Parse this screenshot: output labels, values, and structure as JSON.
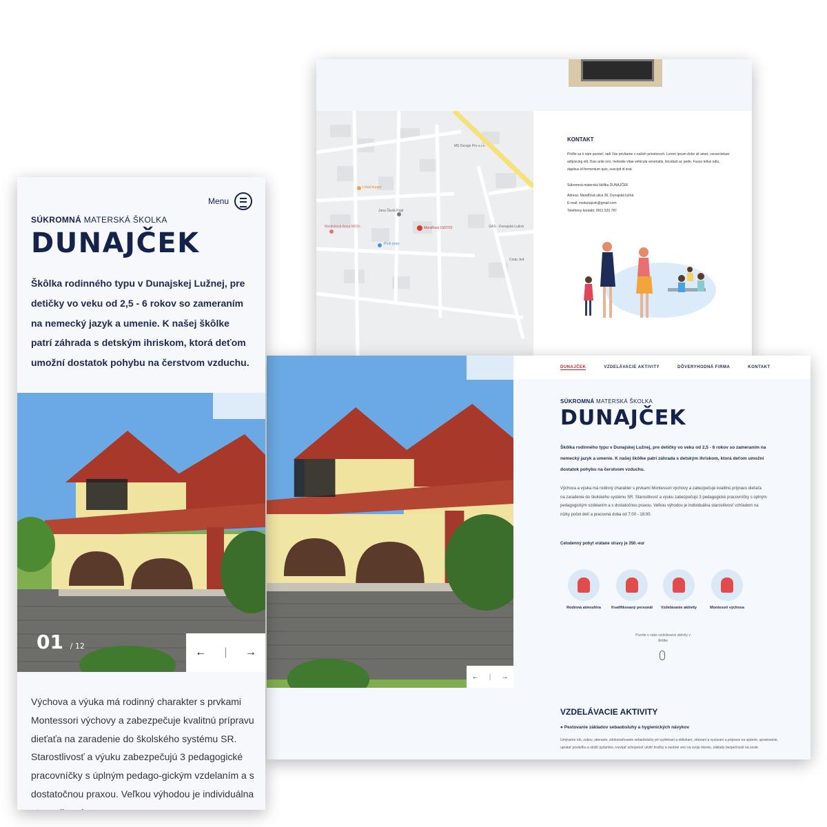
{
  "back": {
    "map": {
      "labels": [
        "Mandľová 1937/32",
        "Lokál burger",
        "Jana Školá Rojé",
        "MS Design Pro s.r.o.",
        "Martinková Anna MUDr.",
        "Pruh popy",
        "GAS - Dunajská Lužná",
        "Coop Jed"
      ]
    },
    "kontakt": {
      "title": "KONTAKT",
      "intro": "Príďte sa k nám pozrieť, radi Vás privítame v našich priestoroch. Lorem ipsum dolor sit amet, consectetuer adipiscing elit. Duis ante orci, molestie vitae vehicula venenatis, tincidunt ac pede. Fusce tellus odio, dapibus id fermentum quis, suscipit id erat.",
      "name": "Súkromná materská škôlka DUNAJČEK",
      "address": "Adresa: Mandľová ulica 36, Dunajská lužná",
      "email": "E-mail: msdunajcek@gmail.com",
      "phone": "Telefónny kontakt: 0911 520 787"
    }
  },
  "front": {
    "nav": [
      "DUNAJČEK",
      "VZDELÁVACIE AKTIVITY",
      "DÔVERYHODNÁ FIRMA",
      "KONTAKT"
    ],
    "sub_bold": "SÚKROMNÁ",
    "sub_rest": " MATERSKÁ ŠKOLKA",
    "logo": "DUNAJČEK",
    "lead": "Škôlka rodinného typu v Dunajskej Lužnej, pre detičky vo veku od 2,5 - 6 rokov so zameraním na nemecký jazyk a umenie. K našej škôlke patrí záhrada s detským ihriskom, ktorá deťom umožní dostatok pohybu na čerstvom vzduchu.",
    "body": "Výchova a výuka má rodinný charakter s prvkami Montessori výchovy a zabezpečuje kvalitnú prípravu dieťaťa na zaradenie do školského systému SR. Starostlivosť a výuku zabezpečujú 3 pedagogické pracovníčky s úplným pedagogickým vzdelaním a s dostatočnou praxou. Veľkou výhodou je individuálna starostlivosť vzhľadom na nízky počet detí a pracovná doba od 7:00 - 18:00.",
    "price": "Celodenný pobyt vrátane stravy je 350.-eur",
    "features": [
      "Rodinná atmosféra",
      "Kvalifikovaný personál",
      "Vzdelávanie aktivity",
      "Montesori výchova"
    ],
    "scroll_hint": "Pozrite s naše vzdelávacie aktivity v škôlke",
    "section_title": "VZDELÁVACIE AKTIVITY",
    "bullet": "Pestovanie základov sebaobsluhy a hygienických návykov",
    "bullet_text": "Umývanie rúk, zubov, utieranie, zdokonaľovanie sebaobsluhy pri vyzliekaní a obliekaní, obúvaní a vyzúvaní a príprave na spánok, upratovanie, upratať postieľku a uložiť pyžamko, rozvíjať schopnosť uložiť hračky a osobné veci na svoje miesto, základy bezpečnosti na ceste.",
    "prev": "←",
    "next": "→"
  },
  "mobile": {
    "menu": "Menu",
    "sub_bold": "SÚKROMNÁ",
    "sub_rest": " MATERSKÁ ŠKOLKA",
    "logo": "DUNAJČEK",
    "lead": "Škôlka rodinného typu v Dunajskej Lužnej, pre detičky vo veku od 2,5 - 6 rokov so zameraním na nemecký jazyk a umenie. K našej škôlke patrí záhrada s detským ihriskom, ktorá deťom umožní dostatok pohybu na čerstvom vzduchu.",
    "counter": "01",
    "counter_total": "/ 12",
    "prev": "←",
    "next": "→",
    "body": "Výchova a výuka má rodinný charakter s prvkami Montessori výchovy a zabezpečuje kvalitnú prípravu dieťaťa na zaradenie do školského systému SR. Starostlivosť a výuku zabezpečujú 3 pedagogické pracovníčky s úplným pedago-gickým vzdelaním a s dostatočnou praxou. Veľkou výhodou je individuálna starostlivosť"
  },
  "colors": {
    "navy": "#15224a",
    "accent": "#c52121",
    "bg": "#f5f8fc"
  }
}
